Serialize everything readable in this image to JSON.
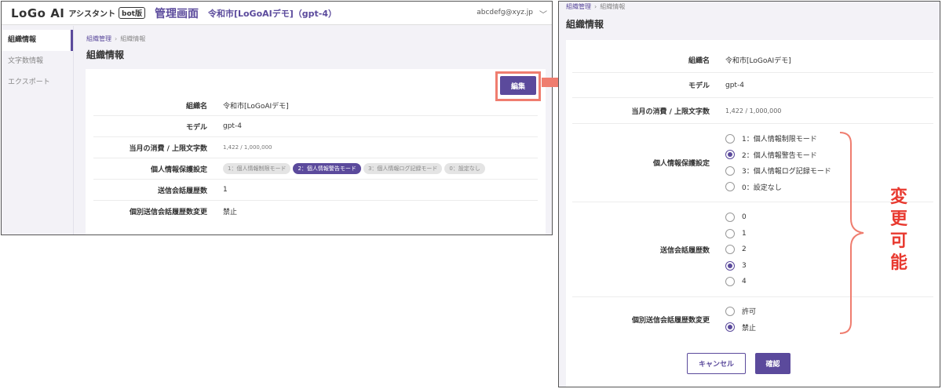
{
  "left": {
    "header": {
      "logo_text": "LoGo AI",
      "logo_sub": "アシスタント",
      "logo_badge": "bot版",
      "admin_title": "管理画面",
      "org_title": "令和市[LoGoAIデモ]（gpt-4）",
      "user_email": "abcdefg@xyz.jp"
    },
    "sidebar": {
      "items": [
        {
          "label": "組織情報",
          "active": true
        },
        {
          "label": "文字数情報",
          "active": false
        },
        {
          "label": "エクスポート",
          "active": false
        }
      ]
    },
    "breadcrumb": {
      "parent": "組織管理",
      "current": "組織情報"
    },
    "page_title": "組織情報",
    "edit_label": "編集",
    "rows": [
      {
        "label": "組織名",
        "value": "令和市[LoGoAIデモ]"
      },
      {
        "label": "モデル",
        "value": "gpt-4"
      },
      {
        "label": "当月の消費 / 上限文字数",
        "value": "1,422 / 1,000,000"
      },
      {
        "label": "個人情報保護設定",
        "chips": [
          "1：個人情報制限モード",
          "2：個人情報警告モード",
          "3：個人情報ログ記録モード",
          "0：設定なし"
        ],
        "selected": 1
      },
      {
        "label": "送信会話履歴数",
        "value": "1"
      },
      {
        "label": "個別送信会話履歴数変更",
        "value": "禁止"
      }
    ]
  },
  "right": {
    "breadcrumb": {
      "parent": "組織管理",
      "current": "組織情報"
    },
    "page_title": "組織情報",
    "org_name": {
      "label": "組織名",
      "value": "令和市[LoGoAIデモ]"
    },
    "model": {
      "label": "モデル",
      "value": "gpt-4"
    },
    "usage": {
      "label": "当月の消費 / 上限文字数",
      "value": "1,422 / 1,000,000"
    },
    "privacy": {
      "label": "個人情報保護設定",
      "options": [
        "1：個人情報制限モード",
        "2：個人情報警告モード",
        "3：個人情報ログ記録モード",
        "0：設定なし"
      ],
      "selected": 1
    },
    "history": {
      "label": "送信会話履歴数",
      "options": [
        "0",
        "1",
        "2",
        "3",
        "4"
      ],
      "selected": 3
    },
    "history_change": {
      "label": "個別送信会話履歴数変更",
      "options": [
        "許可",
        "禁止"
      ],
      "selected": 1
    },
    "cancel_label": "キャンセル",
    "confirm_label": "確認"
  },
  "annotation": {
    "text": "変更可能",
    "color": "#e8392f"
  },
  "colors": {
    "accent": "#5b4a9c",
    "highlight": "#ef7d6f"
  }
}
